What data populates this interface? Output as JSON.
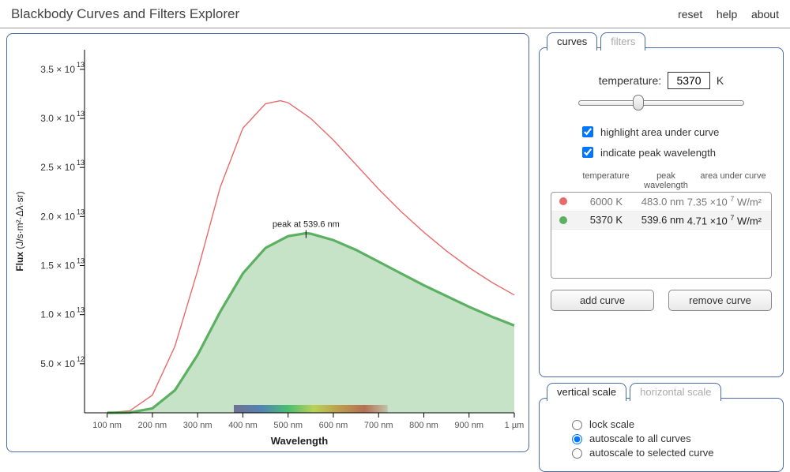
{
  "header": {
    "title": "Blackbody Curves and Filters Explorer",
    "links": {
      "reset": "reset",
      "help": "help",
      "about": "about"
    }
  },
  "chart_data": {
    "type": "line",
    "title": "",
    "xlabel": "Wavelength",
    "ylabel": "Flux  (J/s·m²·Δλ·sr)",
    "xlim_nm": [
      50,
      1000
    ],
    "ylim": [
      0,
      37000000000000.0
    ],
    "x_ticks_nm": [
      100,
      200,
      300,
      400,
      500,
      600,
      700,
      800,
      900,
      1000
    ],
    "x_tick_labels": [
      "100 nm",
      "200 nm",
      "300 nm",
      "400 nm",
      "500 nm",
      "600 nm",
      "700 nm",
      "800 nm",
      "900 nm",
      "1 µm"
    ],
    "y_ticks": [
      5000000000000.0,
      10000000000000.0,
      15000000000000.0,
      20000000000000.0,
      25000000000000.0,
      30000000000000.0,
      35000000000000.0
    ],
    "y_tick_labels": [
      "5.0 × 10^12",
      "1.0 × 10^13",
      "1.5 × 10^13",
      "2.0 × 10^13",
      "2.5 × 10^13",
      "3.0 × 10^13",
      "3.5 × 10^13"
    ],
    "peak_annotation": "peak at 539.6 nm",
    "visible_spectrum_nm": [
      380,
      720
    ],
    "series": [
      {
        "name": "6000 K",
        "color": "#e86b6b",
        "fill": false,
        "selected": false,
        "x_nm": [
          100,
          150,
          200,
          250,
          300,
          350,
          400,
          450,
          483,
          500,
          550,
          600,
          650,
          700,
          750,
          800,
          850,
          900,
          950,
          1000
        ],
        "y": [
          0,
          200000000000.0,
          1800000000000.0,
          6800000000000.0,
          14500000000000.0,
          23000000000000.0,
          29000000000000.0,
          31500000000000.0,
          31800000000000.0,
          31600000000000.0,
          30000000000000.0,
          27800000000000.0,
          25300000000000.0,
          22800000000000.0,
          20500000000000.0,
          18400000000000.0,
          16500000000000.0,
          14800000000000.0,
          13300000000000.0,
          12000000000000.0
        ]
      },
      {
        "name": "5370 K",
        "color": "#5bb061",
        "fill": true,
        "selected": true,
        "x_nm": [
          100,
          150,
          200,
          250,
          300,
          350,
          400,
          450,
          500,
          539.6,
          550,
          600,
          650,
          700,
          750,
          800,
          850,
          900,
          950,
          1000
        ],
        "y": [
          0,
          30000000000.0,
          450000000000.0,
          2300000000000.0,
          5900000000000.0,
          10300000000000.0,
          14200000000000.0,
          16800000000000.0,
          18000000000000.0,
          18300000000000.0,
          18250000000000.0,
          17600000000000.0,
          16600000000000.0,
          15400000000000.0,
          14200000000000.0,
          13000000000000.0,
          11900000000000.0,
          10800000000000.0,
          9800000000000.0,
          8900000000000.0
        ]
      }
    ]
  },
  "controls": {
    "tab_curves": "curves",
    "tab_filters": "filters",
    "temperature_label": "temperature:",
    "temperature_value": "5370",
    "temperature_unit": "K",
    "highlight_label": "highlight area under curve",
    "highlight_checked": true,
    "indicate_label": "indicate peak wavelength",
    "indicate_checked": true,
    "list_headers": {
      "temp": "temperature",
      "peak": "peak\nwavelength",
      "area": "area under curve"
    },
    "rows": [
      {
        "color": "#e86b6b",
        "temp": "6000 K",
        "peak": "483.0 nm",
        "area_m": "7.35",
        "area_e": "7",
        "area_unit": "W/m²",
        "selected": false
      },
      {
        "color": "#5bb061",
        "temp": "5370 K",
        "peak": "539.6 nm",
        "area_m": "4.71",
        "area_e": "7",
        "area_unit": "W/m²",
        "selected": true
      }
    ],
    "add_label": "add curve",
    "remove_label": "remove curve"
  },
  "scale": {
    "tab_v": "vertical scale",
    "tab_h": "horizontal scale",
    "opt_lock": "lock scale",
    "opt_all": "autoscale to all curves",
    "opt_sel": "autoscale to selected curve",
    "selected": "opt_all"
  }
}
